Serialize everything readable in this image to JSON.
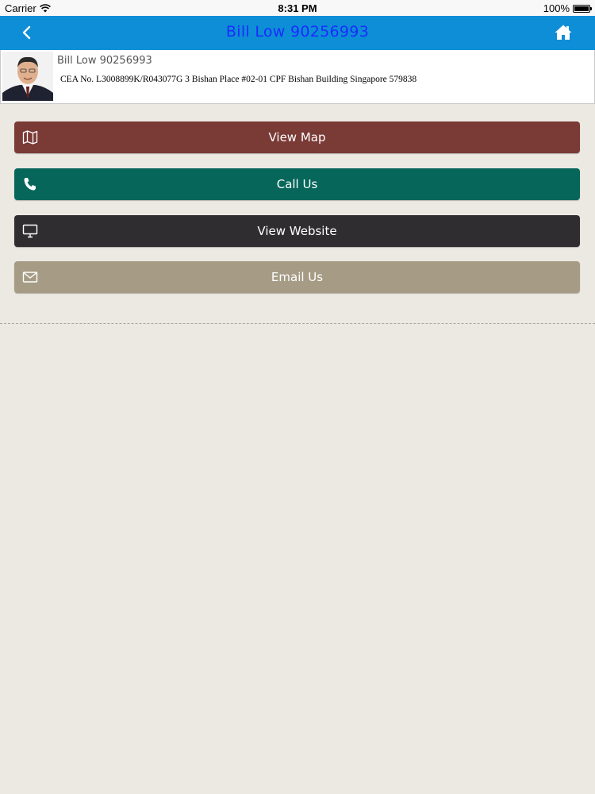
{
  "status_bar": {
    "carrier": "Carrier",
    "time": "8:31 PM",
    "battery": "100%"
  },
  "nav": {
    "title": "Bill Low  90256993",
    "back_icon": "chevron-left-icon",
    "home_icon": "home-icon"
  },
  "profile": {
    "name": "Bill Low  90256993",
    "address": "CEA No. L3008899K/R043077G 3 Bishan Place #02-01 CPF Bishan Building Singapore 579838"
  },
  "actions": [
    {
      "label": "View Map",
      "icon": "map-icon",
      "color": "#7a3a36"
    },
    {
      "label": "Call Us",
      "icon": "phone-icon",
      "color": "#06665a"
    },
    {
      "label": "View Website",
      "icon": "monitor-icon",
      "color": "#302d30"
    },
    {
      "label": "Email Us",
      "icon": "envelope-icon",
      "color": "#a69c85"
    }
  ],
  "colors": {
    "nav_bar": "#0d8ed6",
    "nav_title": "#1a2cff",
    "background": "#ece9e2"
  }
}
